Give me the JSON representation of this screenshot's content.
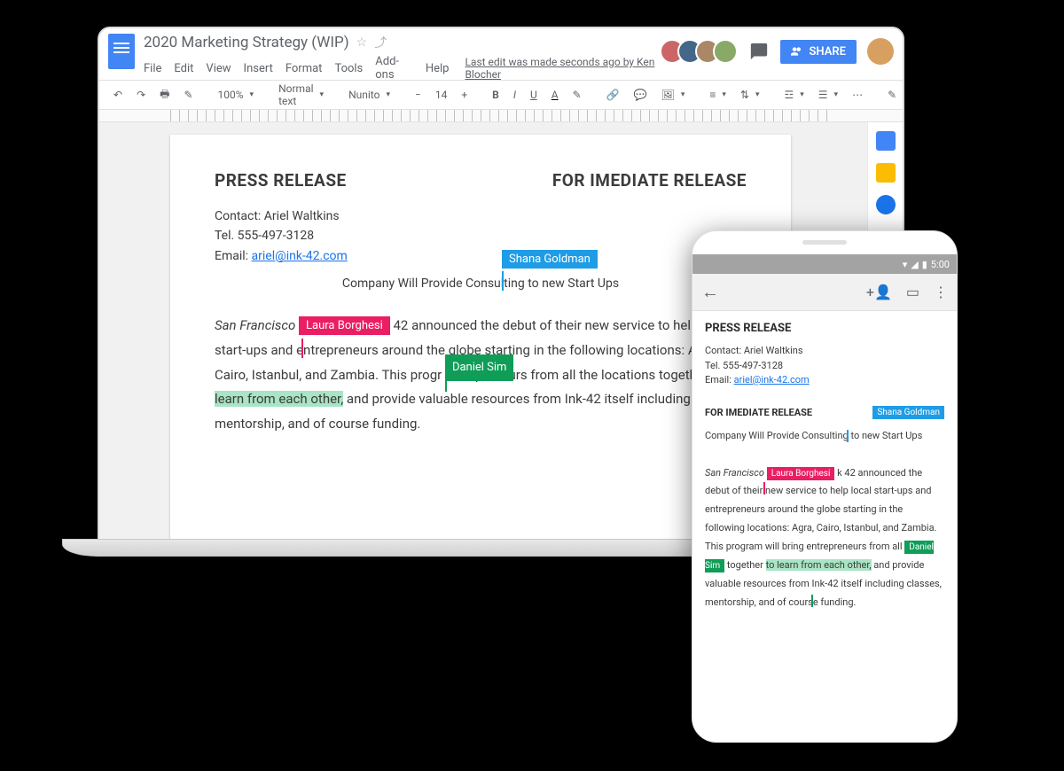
{
  "header": {
    "doc_title": "2020 Marketing Strategy (WIP)",
    "menus": [
      "File",
      "Edit",
      "View",
      "Insert",
      "Format",
      "Tools",
      "Add-ons",
      "Help"
    ],
    "edit_status": "Last edit was made seconds ago by Ken Blocher",
    "share_label": "SHARE"
  },
  "toolbar": {
    "zoom": "100%",
    "style": "Normal text",
    "font": "Nunito",
    "font_size": "14"
  },
  "document": {
    "title_left": "PRESS RELEASE",
    "title_right": "FOR IMEDIATE RELEASE",
    "contact_name": "Contact: Ariel Waltkins",
    "tel": "Tel. 555-497-3128",
    "email_label": "Email: ",
    "email": "ariel@ink-42.com",
    "subtitle_a": "Company Will Provide Consulting",
    "subtitle_b": " to new Start Ups",
    "body_city": "San Francisco",
    "body_p1a": " 42 announced the debut of their new service to help local start-ups and entrepreneurs around the globe starting in the following locations: Agra, Cairo, Istanbul, and Zambia. This progr",
    "body_p1b": " entrepreneurs from all the locations together to ",
    "body_highlight": "learn from each other,",
    "body_p1c": " and provide valuable resources from Ink-42 itself including classes, mentorship, and of course funding."
  },
  "collaborators": {
    "shana": "Shana Goldman",
    "laura": "Laura Borghesi",
    "daniel": "Daniel Sim"
  },
  "phone": {
    "time": "5:00",
    "title": "PRESS RELEASE",
    "subtitle": "FOR IMEDIATE RELEASE",
    "consulting_a": "Company Will Provide Consulting",
    "consulting_b": " to new Start Ups",
    "body_city": "San Francisco",
    "body_a": "k 42 announced the debut of their new service to help local start-ups and entrepreneurs around the globe starting in the following locations: Agra, Cairo, Istanbul, and Zambia. This program will bring entrepreneurs from all ",
    "body_b": "together ",
    "body_highlight": "to learn from each other,",
    "body_c": " and provide valuable resources from Ink-42 itself including classes, mentorship, and of course funding."
  }
}
